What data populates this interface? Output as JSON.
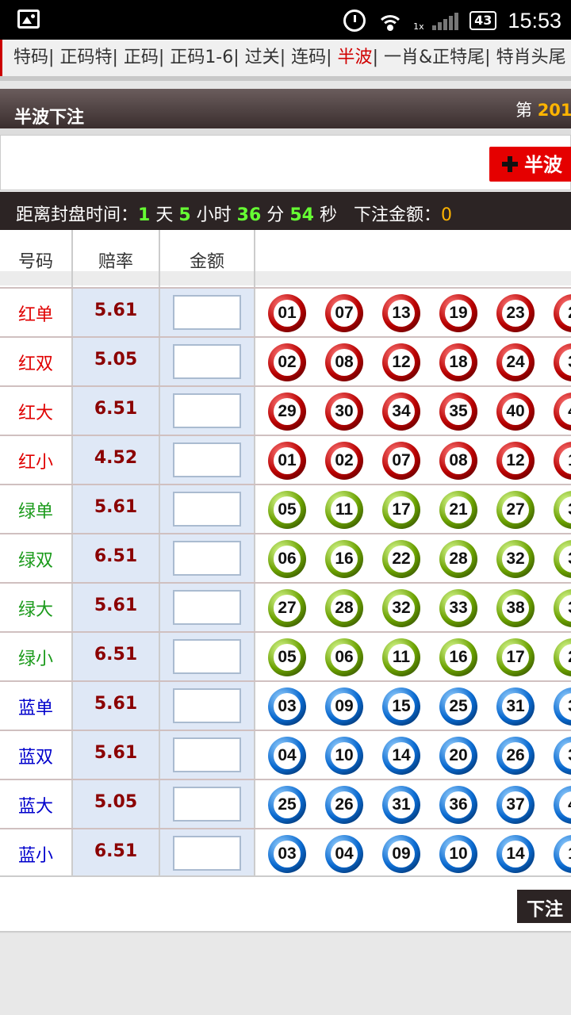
{
  "status_bar": {
    "time": "15:53",
    "battery": "43",
    "network": "1x",
    "icons": [
      "gallery-icon",
      "alarm-icon",
      "wifi-icon",
      "signal-icon",
      "battery-icon"
    ]
  },
  "nav": {
    "items": [
      {
        "label": "特码",
        "active": false
      },
      {
        "label": "正码特",
        "active": false
      },
      {
        "label": "正码",
        "active": false
      },
      {
        "label": "正码1-6",
        "active": false
      },
      {
        "label": "过关",
        "active": false
      },
      {
        "label": "连码",
        "active": false
      },
      {
        "label": "半波",
        "active": true
      },
      {
        "label": "一肖&正特尾",
        "active": false
      },
      {
        "label": "特肖头尾",
        "active": false
      }
    ]
  },
  "title": {
    "text": "半波下注",
    "issue_prefix": "第",
    "issue_value": "201"
  },
  "add_button": "半波",
  "countdown": {
    "label": "距离封盘时间：",
    "days": "1",
    "days_unit": "天",
    "hours": "5",
    "hours_unit": "小时",
    "minutes": "36",
    "minutes_unit": "分",
    "seconds": "54",
    "seconds_unit": "秒",
    "amount_label": "下注金额：",
    "amount": "0"
  },
  "table": {
    "headers": [
      "号码",
      "赔率",
      "金额"
    ],
    "rows": [
      {
        "name": "红单",
        "odds": "5.61",
        "color": "red",
        "balls": [
          "01",
          "07",
          "13",
          "19",
          "23",
          "2"
        ]
      },
      {
        "name": "红双",
        "odds": "5.05",
        "color": "red",
        "balls": [
          "02",
          "08",
          "12",
          "18",
          "24",
          "3"
        ]
      },
      {
        "name": "红大",
        "odds": "6.51",
        "color": "red",
        "balls": [
          "29",
          "30",
          "34",
          "35",
          "40",
          "4"
        ]
      },
      {
        "name": "红小",
        "odds": "4.52",
        "color": "red",
        "balls": [
          "01",
          "02",
          "07",
          "08",
          "12",
          "1"
        ]
      },
      {
        "name": "绿单",
        "odds": "5.61",
        "color": "green",
        "balls": [
          "05",
          "11",
          "17",
          "21",
          "27",
          "3"
        ]
      },
      {
        "name": "绿双",
        "odds": "6.51",
        "color": "green",
        "balls": [
          "06",
          "16",
          "22",
          "28",
          "32",
          "3"
        ]
      },
      {
        "name": "绿大",
        "odds": "5.61",
        "color": "green",
        "balls": [
          "27",
          "28",
          "32",
          "33",
          "38",
          "3"
        ]
      },
      {
        "name": "绿小",
        "odds": "6.51",
        "color": "green",
        "balls": [
          "05",
          "06",
          "11",
          "16",
          "17",
          "2"
        ]
      },
      {
        "name": "蓝单",
        "odds": "5.61",
        "color": "blue",
        "balls": [
          "03",
          "09",
          "15",
          "25",
          "31",
          "3"
        ]
      },
      {
        "name": "蓝双",
        "odds": "5.61",
        "color": "blue",
        "balls": [
          "04",
          "10",
          "14",
          "20",
          "26",
          "3"
        ]
      },
      {
        "name": "蓝大",
        "odds": "5.05",
        "color": "blue",
        "balls": [
          "25",
          "26",
          "31",
          "36",
          "37",
          "4"
        ]
      },
      {
        "name": "蓝小",
        "odds": "6.51",
        "color": "blue",
        "balls": [
          "03",
          "04",
          "09",
          "10",
          "14",
          "1"
        ]
      }
    ]
  },
  "submit_button": "下注",
  "colors": {
    "red_text": "#e00000",
    "green_text": "#1a9a1a",
    "blue_text": "#0000cc",
    "odds": "#8b0000",
    "highlight_green": "#66ff33",
    "highlight_yellow": "#ffb400",
    "add_button_bg": "#e50000"
  }
}
